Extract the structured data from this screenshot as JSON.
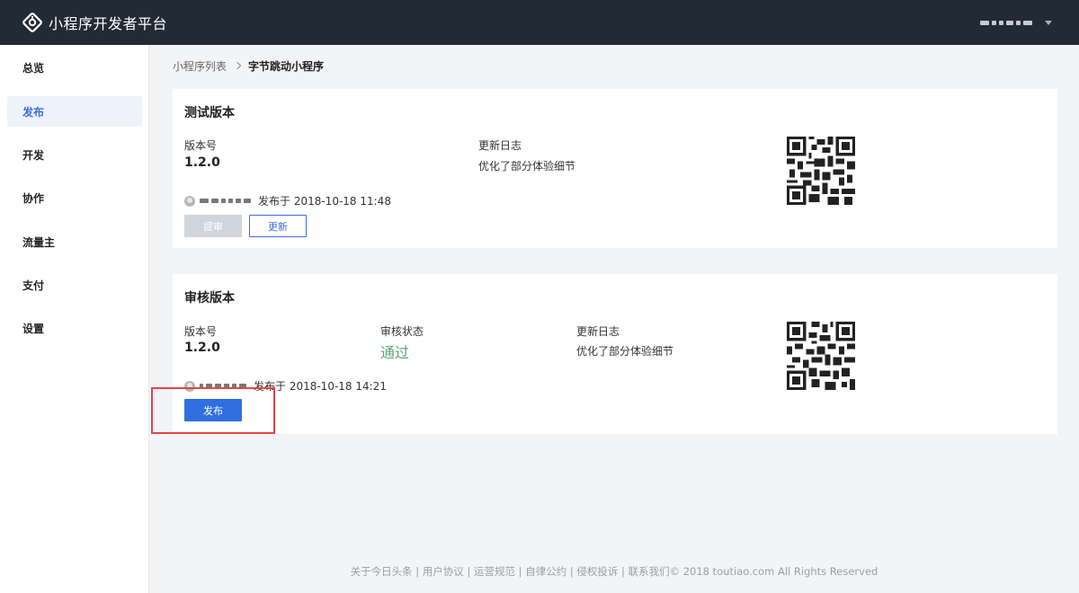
{
  "header": {
    "brand": "小程序开发者平台",
    "logo_icon": "bytedance-miniprogram-logo",
    "user_menu_icon": "caret-down-icon"
  },
  "sidebar": {
    "items": [
      {
        "label": "总览",
        "active": false
      },
      {
        "label": "发布",
        "active": true
      },
      {
        "label": "开发",
        "active": false
      },
      {
        "label": "协作",
        "active": false
      },
      {
        "label": "流量主",
        "active": false
      },
      {
        "label": "支付",
        "active": false
      },
      {
        "label": "设置",
        "active": false
      }
    ]
  },
  "breadcrumb": {
    "parent": "小程序列表",
    "current": "字节跳动小程序"
  },
  "test_version": {
    "title": "测试版本",
    "version_label": "版本号",
    "version_value": "1.2.0",
    "changelog_label": "更新日志",
    "changelog_value": "优化了部分体验细节",
    "published_text": "发布于 2018-10-18 11:48",
    "submit_button": "提审",
    "update_button": "更新"
  },
  "review_version": {
    "title": "审核版本",
    "version_label": "版本号",
    "version_value": "1.2.0",
    "status_label": "审核状态",
    "status_value": "通过",
    "changelog_label": "更新日志",
    "changelog_value": "优化了部分体验细节",
    "published_text": "发布于 2018-10-18 14:21",
    "publish_button": "发布"
  },
  "colors": {
    "header_bg": "#222a35",
    "accent": "#2f6fe0",
    "status_ok": "#58a56d",
    "highlight": "#e04646"
  },
  "footer": {
    "text": "关于今日头条 | 用户协议 | 运营规范 | 自律公约 | 侵权投诉 | 联系我们© 2018 toutiao.com All Rights Reserved"
  }
}
